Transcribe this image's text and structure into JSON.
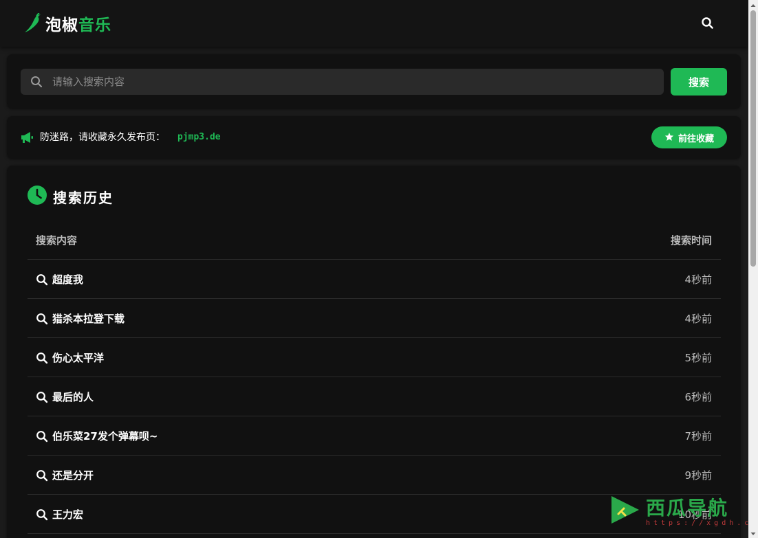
{
  "header": {
    "logo_text": "泡椒",
    "logo_accent": "音乐",
    "logo_icon": "chili-pepper-icon",
    "search_icon": "search-icon"
  },
  "search": {
    "placeholder": "请输入搜索内容",
    "value": "",
    "button_label": "搜索"
  },
  "notice": {
    "text": "防迷路，请收藏永久发布页：",
    "link": "pjmp3.de",
    "button_label": "前往收藏",
    "icon": "megaphone-icon",
    "button_icon": "star-icon"
  },
  "history": {
    "title": "搜索历史",
    "title_icon": "clock-icon",
    "columns": {
      "query": "搜索内容",
      "time": "搜索时间"
    },
    "rows": [
      {
        "query": "超度我",
        "time": "4秒前"
      },
      {
        "query": "猎杀本拉登下载",
        "time": "4秒前"
      },
      {
        "query": "伤心太平洋",
        "time": "5秒前"
      },
      {
        "query": "最后的人",
        "time": "6秒前"
      },
      {
        "query": "伯乐菜27发个弹幕呗~",
        "time": "7秒前"
      },
      {
        "query": "还是分开",
        "time": "9秒前"
      },
      {
        "query": "王力宏",
        "time": "10秒前"
      }
    ]
  },
  "watermark": {
    "title": "西瓜导航",
    "url": "https://xgdh.cc"
  },
  "colors": {
    "accent": "#1fb955",
    "background": "#1b1b1b",
    "card": "#111111",
    "header": "#141414"
  }
}
